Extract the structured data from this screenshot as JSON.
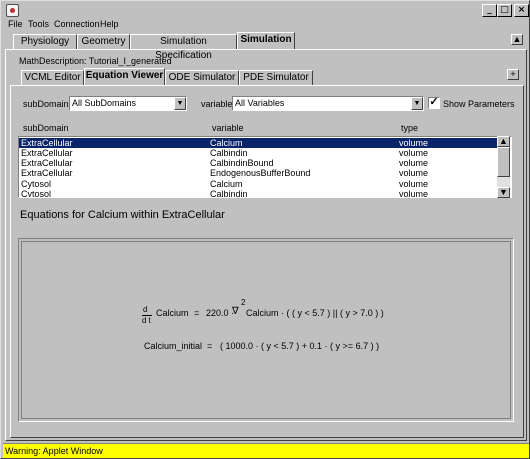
{
  "window": {
    "minimize": "_",
    "maximize": "□",
    "close": "×",
    "menu": [
      "File",
      "Tools",
      "Connection",
      "Help"
    ]
  },
  "top_tabs": [
    "Physiology",
    "Geometry",
    "Simulation Specification",
    "Simulation"
  ],
  "math_description": "MathDescription: Tutorial_I_generated",
  "sub_tabs": [
    "VCML Editor",
    "Equation Viewer",
    "ODE Simulator",
    "PDE Simulator"
  ],
  "filters": {
    "subdomain_label": "subDomain",
    "subdomain_value": "All SubDomains",
    "variable_label": "variable",
    "variable_value": "All Variables",
    "show_parameters_label": "Show Parameters",
    "show_parameters_checked": true
  },
  "table": {
    "columns": [
      "subDomain",
      "variable",
      "type"
    ],
    "rows": [
      [
        "ExtraCellular",
        "Calcium",
        "volume"
      ],
      [
        "ExtraCellular",
        "Calbindin",
        "volume"
      ],
      [
        "ExtraCellular",
        "CalbindinBound",
        "volume"
      ],
      [
        "ExtraCellular",
        "EndogenousBufferBound",
        "volume"
      ],
      [
        "Cytosol",
        "Calcium",
        "volume"
      ],
      [
        "Cytosol",
        "Calbindin",
        "volume"
      ]
    ],
    "selected_row": 0
  },
  "equations": {
    "heading": "Equations for Calcium within ExtraCellular",
    "d": "d",
    "dt": "d t",
    "eq1_var": "Calcium",
    "eq1_eq": "=",
    "eq1_coef": "220.0 ·",
    "nabla": "∇",
    "exp": "2",
    "eq1_rhs": "Calcium · ( ( y < 5.7 ) || ( y > 7.0 ) )",
    "eq2_lhs": "Calcium_initial",
    "eq2_eq": "=",
    "eq2_rhs": "( 1000.0 · ( y < 5.7 ) + 0.1 · ( y >= 6.7 ) )"
  },
  "status": "Warning: Applet Window"
}
